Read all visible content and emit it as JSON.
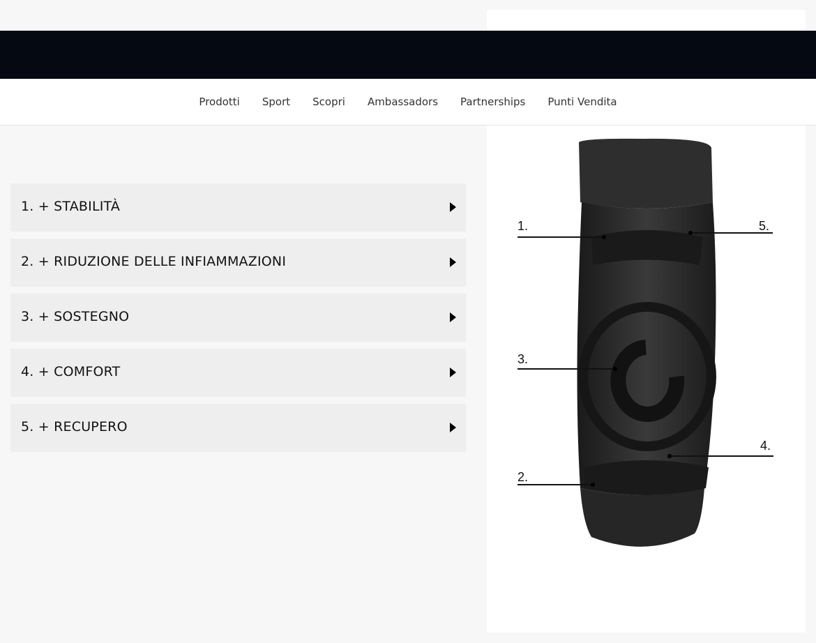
{
  "nav": {
    "items": [
      "Prodotti",
      "Sport",
      "Scopri",
      "Ambassadors",
      "Partnerships",
      "Punti Vendita"
    ]
  },
  "accordion": {
    "items": [
      {
        "label": "1. + STABILITÀ"
      },
      {
        "label": "2. + RIDUZIONE DELLE INFIAMMAZIONI"
      },
      {
        "label": "3. + SOSTEGNO"
      },
      {
        "label": "4. + COMFORT"
      },
      {
        "label": "5. + RECUPERO"
      }
    ]
  },
  "product_image": {
    "callouts": [
      "1.",
      "5.",
      "3.",
      "4.",
      "2."
    ]
  },
  "colors": {
    "header_band": "#050911",
    "accordion_bg": "#eeeeee",
    "page_bg": "#f7f7f7"
  }
}
